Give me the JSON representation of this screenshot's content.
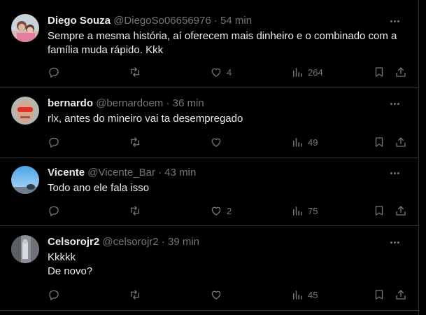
{
  "replies": [
    {
      "name": "Diego Souza",
      "handle": "@DiegoSo06656976",
      "sep": "·",
      "time": "54 min",
      "lines": [
        "Sempre a mesma história, aí oferecem mais dinheiro e o combinado com a",
        "família muda rápido.  Kkk"
      ],
      "likes": "4",
      "views": "264",
      "avatar_icon": "avatar-photo-family"
    },
    {
      "name": "bernardo",
      "handle": "@bernardoem",
      "sep": "·",
      "time": "36 min",
      "lines": [
        "rlx, antes do mineiro vai ta desempregado"
      ],
      "likes": "",
      "views": "49",
      "avatar_icon": "avatar-photo-sunglasses"
    },
    {
      "name": "Vicente",
      "handle": "@Vicente_Bar",
      "sep": "·",
      "time": "43 min",
      "lines": [
        "Todo ano ele fala isso"
      ],
      "likes": "2",
      "views": "75",
      "avatar_icon": "avatar-photo-sky"
    },
    {
      "name": "Celsorojr2",
      "handle": "@celsorojr2",
      "sep": "·",
      "time": "39 min",
      "lines": [
        "Kkkkk",
        "De novo?"
      ],
      "likes": "",
      "views": "45",
      "avatar_icon": "avatar-photo-street"
    }
  ],
  "colors": {
    "background": "#000000",
    "text": "#e7e9ea",
    "muted": "#71767b",
    "divider": "#2f3336"
  },
  "icons": [
    "reply-icon",
    "repost-icon",
    "like-icon",
    "views-icon",
    "bookmark-icon",
    "share-icon",
    "more-icon"
  ]
}
